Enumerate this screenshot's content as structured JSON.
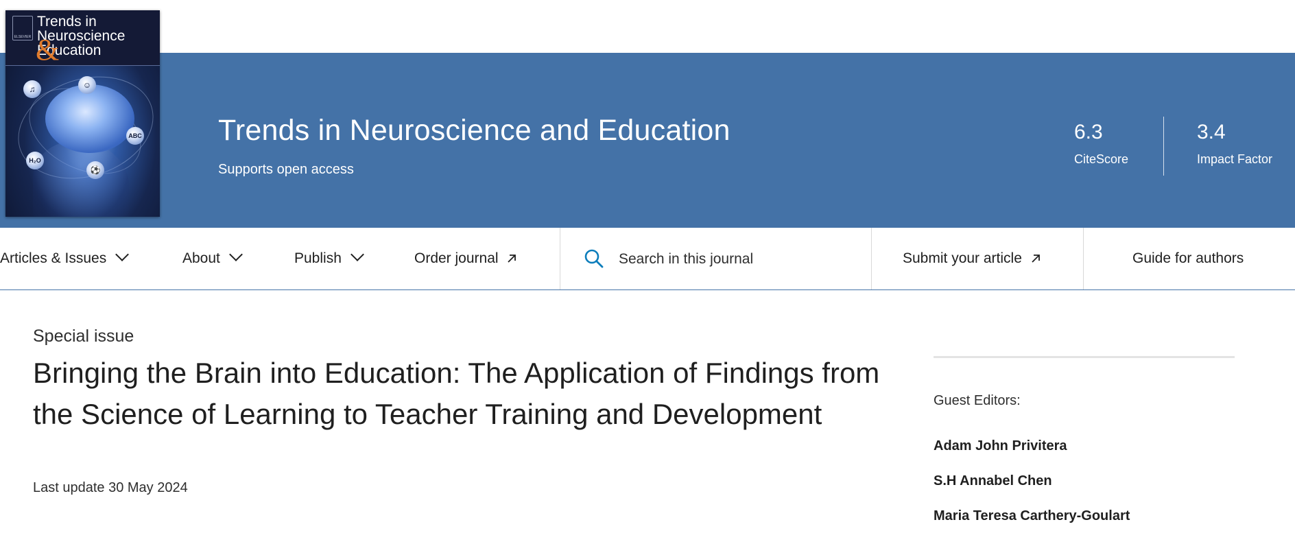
{
  "cover": {
    "title_lines": "Trends in\nNeuroscience\nEducation",
    "ampersand": "&",
    "publisher": "ELSEVIER",
    "orbs": [
      "♫",
      "ABC",
      "⚽",
      "H₂O",
      "☺"
    ]
  },
  "header": {
    "journal_title": "Trends in Neuroscience and Education",
    "open_access": "Supports open access",
    "citescore_value": "6.3",
    "citescore_label": "CiteScore",
    "impact_value": "3.4",
    "impact_label": "Impact Factor",
    "band_color": "#4472a7"
  },
  "nav": {
    "articles_issues": "Articles & Issues",
    "about": "About",
    "publish": "Publish",
    "order_journal": "Order journal",
    "search_placeholder": "Search in this journal",
    "submit_article": "Submit your article",
    "guide_authors": "Guide for authors",
    "accent_color": "#0c7dbb"
  },
  "main": {
    "label": "Special issue",
    "title": "Bringing the Brain into Education: The Application of Findings from the Science of Learning to Teacher Training and Development",
    "last_update": "Last update 30 May 2024"
  },
  "sidebar": {
    "guest_label": "Guest Editors:",
    "editors": [
      "Adam John Privitera",
      "S.H Annabel Chen",
      "Maria Teresa Carthery-Goulart"
    ]
  }
}
